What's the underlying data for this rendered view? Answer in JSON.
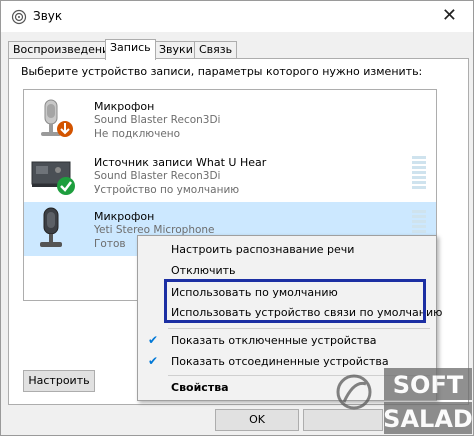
{
  "window": {
    "title": "Звук",
    "close_symbol": "✕"
  },
  "tabs": [
    {
      "label": "Воспроизведение",
      "active": false
    },
    {
      "label": "Запись",
      "active": true
    },
    {
      "label": "Звуки",
      "active": false
    },
    {
      "label": "Связь",
      "active": false
    }
  ],
  "panel": {
    "prompt": "Выберите устройство записи, параметры которого нужно изменить:"
  },
  "devices": [
    {
      "name": "Микрофон",
      "driver": "Sound Blaster Recon3Di",
      "status": "Не подключено",
      "icon": "microphone-icon",
      "badge": "disconnected-arrow-icon",
      "selected": false
    },
    {
      "name": "Источник записи What U Hear",
      "driver": "Sound Blaster Recon3Di",
      "status": "Устройство по умолчанию",
      "icon": "soundcard-icon",
      "badge": "default-check-icon",
      "selected": false
    },
    {
      "name": "Микрофон",
      "driver": "Yeti Stereo Microphone",
      "status": "Готов",
      "icon": "microphone-icon",
      "badge": "",
      "selected": true
    }
  ],
  "context_menu": {
    "items": [
      {
        "label": "Настроить распознавание речи",
        "checked": false,
        "bold": false
      },
      {
        "label": "Отключить",
        "checked": false,
        "bold": false
      },
      {
        "label": "Использовать по умолчанию",
        "checked": false,
        "bold": false
      },
      {
        "label": "Использовать устройство связи по умолчанию",
        "checked": false,
        "bold": false
      },
      {
        "label": "Показать отключенные устройства",
        "checked": true,
        "bold": false
      },
      {
        "label": "Показать отсоединенные устройства",
        "checked": true,
        "bold": false
      },
      {
        "label": "Свойства",
        "checked": false,
        "bold": true
      }
    ],
    "check_symbol": "✔",
    "highlight_color": "#1c2fa3"
  },
  "buttons": {
    "configure": "Настроить",
    "ok": "OK"
  },
  "watermark": {
    "top": "SOFT",
    "bottom": "SALAD"
  },
  "colors": {
    "selection": "#cce8ff",
    "accent": "#0078d7",
    "check_badge": "#1e9e3e",
    "down_badge": "#d35400"
  }
}
